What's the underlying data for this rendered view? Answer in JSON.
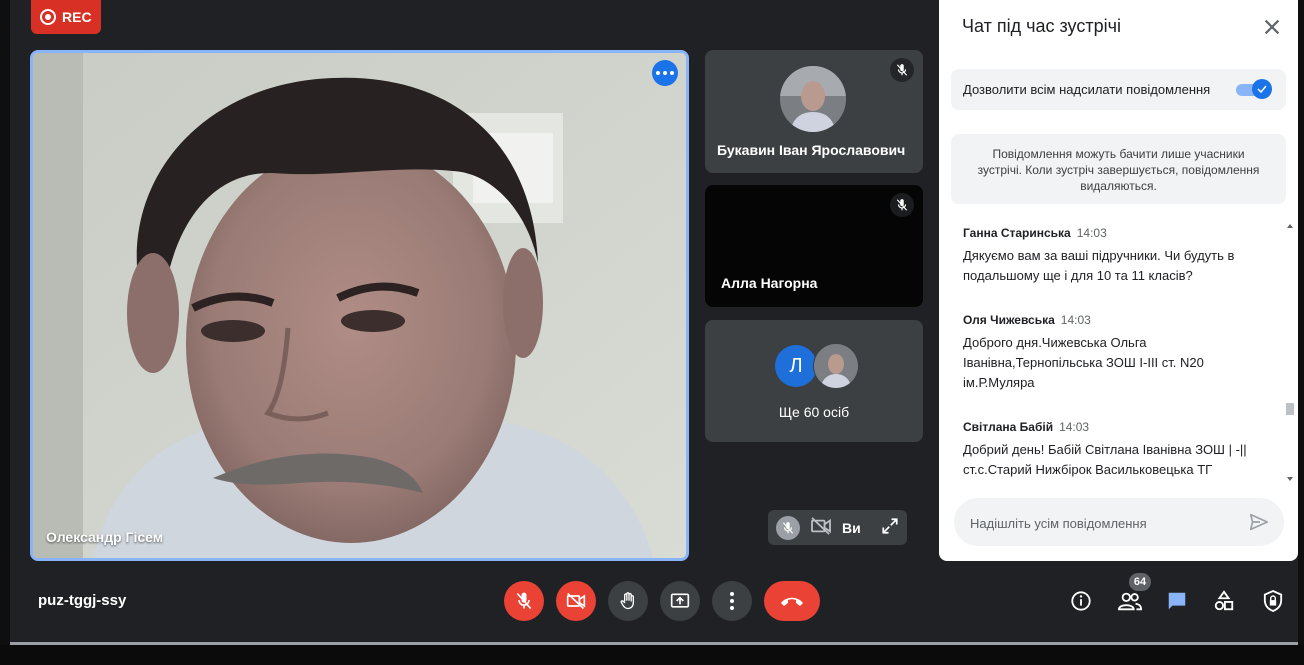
{
  "recording": {
    "label": "REC"
  },
  "main_tile": {
    "participant": "Олександр Гісем"
  },
  "side_tiles": [
    {
      "name": "Букавин Іван Ярославович",
      "muted": true
    },
    {
      "name": "Алла Нагорна",
      "muted": true
    }
  ],
  "others_tile": {
    "avatar_letter": "Л",
    "label": "Ще 60 осіб"
  },
  "self_tile": {
    "label": "Ви"
  },
  "chat": {
    "title": "Чат під час зустрічі",
    "allow_label": "Дозволити всім надсилати повідомлення",
    "allow_enabled": true,
    "info": "Повідомлення можуть бачити лише учасники зустрічі. Коли зустріч завершується, повідомлення видаляються.",
    "messages": [
      {
        "author": "Ганна Старинська",
        "time": "14:03",
        "text": "Дякуємо вам за ваші підручники. Чи будуть в подальшому ще і для 10 та 11 класів?"
      },
      {
        "author": "Оля Чижевська",
        "time": "14:03",
        "text": "Доброго дня.Чижевська Ольга Іванівна,Тернопільська ЗОШ  I-III ст.  N20 ім.Р.Муляра"
      },
      {
        "author": "Світлана Бабій",
        "time": "14:03",
        "text": "Добрий день! Бабій Світлана Іванівна ЗОШ | -|| ст.с.Старий Нижбірок Васильковецька ТГ"
      }
    ],
    "compose_placeholder": "Надішліть усім повідомлення"
  },
  "meeting": {
    "code": "puz-tggj-ssy",
    "participants_count": "64"
  },
  "colors": {
    "accent": "#1a73e8",
    "danger": "#ea4335",
    "background": "#202124",
    "tile": "#3c4043"
  }
}
